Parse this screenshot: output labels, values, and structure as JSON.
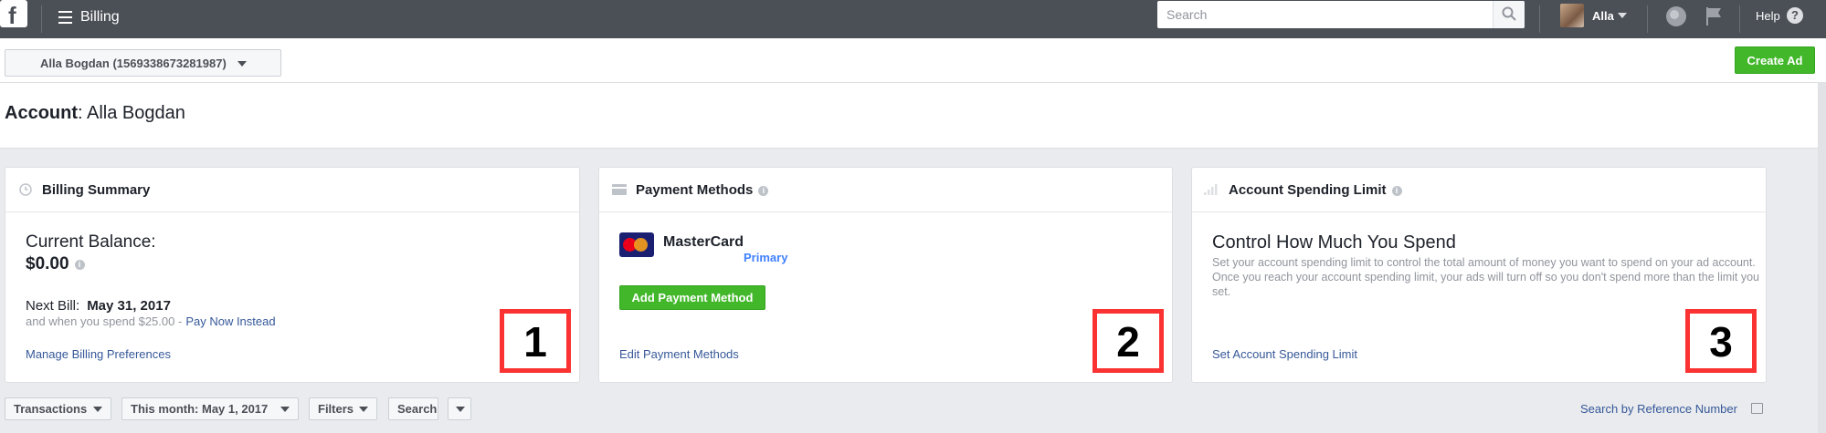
{
  "topbar": {
    "page_title": "Billing",
    "search_placeholder": "Search",
    "user_name": "Alla",
    "help_label": "Help",
    "help_icon": "?"
  },
  "subbar": {
    "account_selector": "Alla Bogdan (1569338673281987)",
    "create_ad_label": "Create Ad"
  },
  "account": {
    "label": "Account",
    "separator": ":",
    "name": "Alla Bogdan"
  },
  "billing_summary": {
    "title": "Billing Summary",
    "balance_label": "Current Balance:",
    "balance_value": "$0.00",
    "next_bill_label": "Next Bill:",
    "next_bill_date": "May 31, 2017",
    "spend_text": "and when you spend $25.00 -",
    "pay_now_link": "Pay Now Instead",
    "manage_link": "Manage Billing Preferences",
    "annotation_number": "1"
  },
  "payment_methods": {
    "title": "Payment Methods",
    "card_name": "MasterCard",
    "card_status": "Primary",
    "add_button": "Add Payment Method",
    "edit_link": "Edit Payment Methods",
    "annotation_number": "2"
  },
  "spending_limit": {
    "title": "Account Spending Limit",
    "heading": "Control How Much You Spend",
    "description": "Set your account spending limit to control the total amount of money you want to spend on your ad account. Once you reach your account spending limit, your ads will turn off so you don't spend more than the limit you set.",
    "set_link": "Set Account Spending Limit",
    "annotation_number": "3"
  },
  "filters": {
    "transactions": "Transactions",
    "date_range": "This month: May 1, 2017",
    "filters": "Filters",
    "search": "Search",
    "reference_link": "Search by Reference Number"
  },
  "colors": {
    "topbar": "#4b4f56",
    "create_green": "#42b72a",
    "link_blue": "#365899",
    "annotation_red": "#fa3232"
  }
}
